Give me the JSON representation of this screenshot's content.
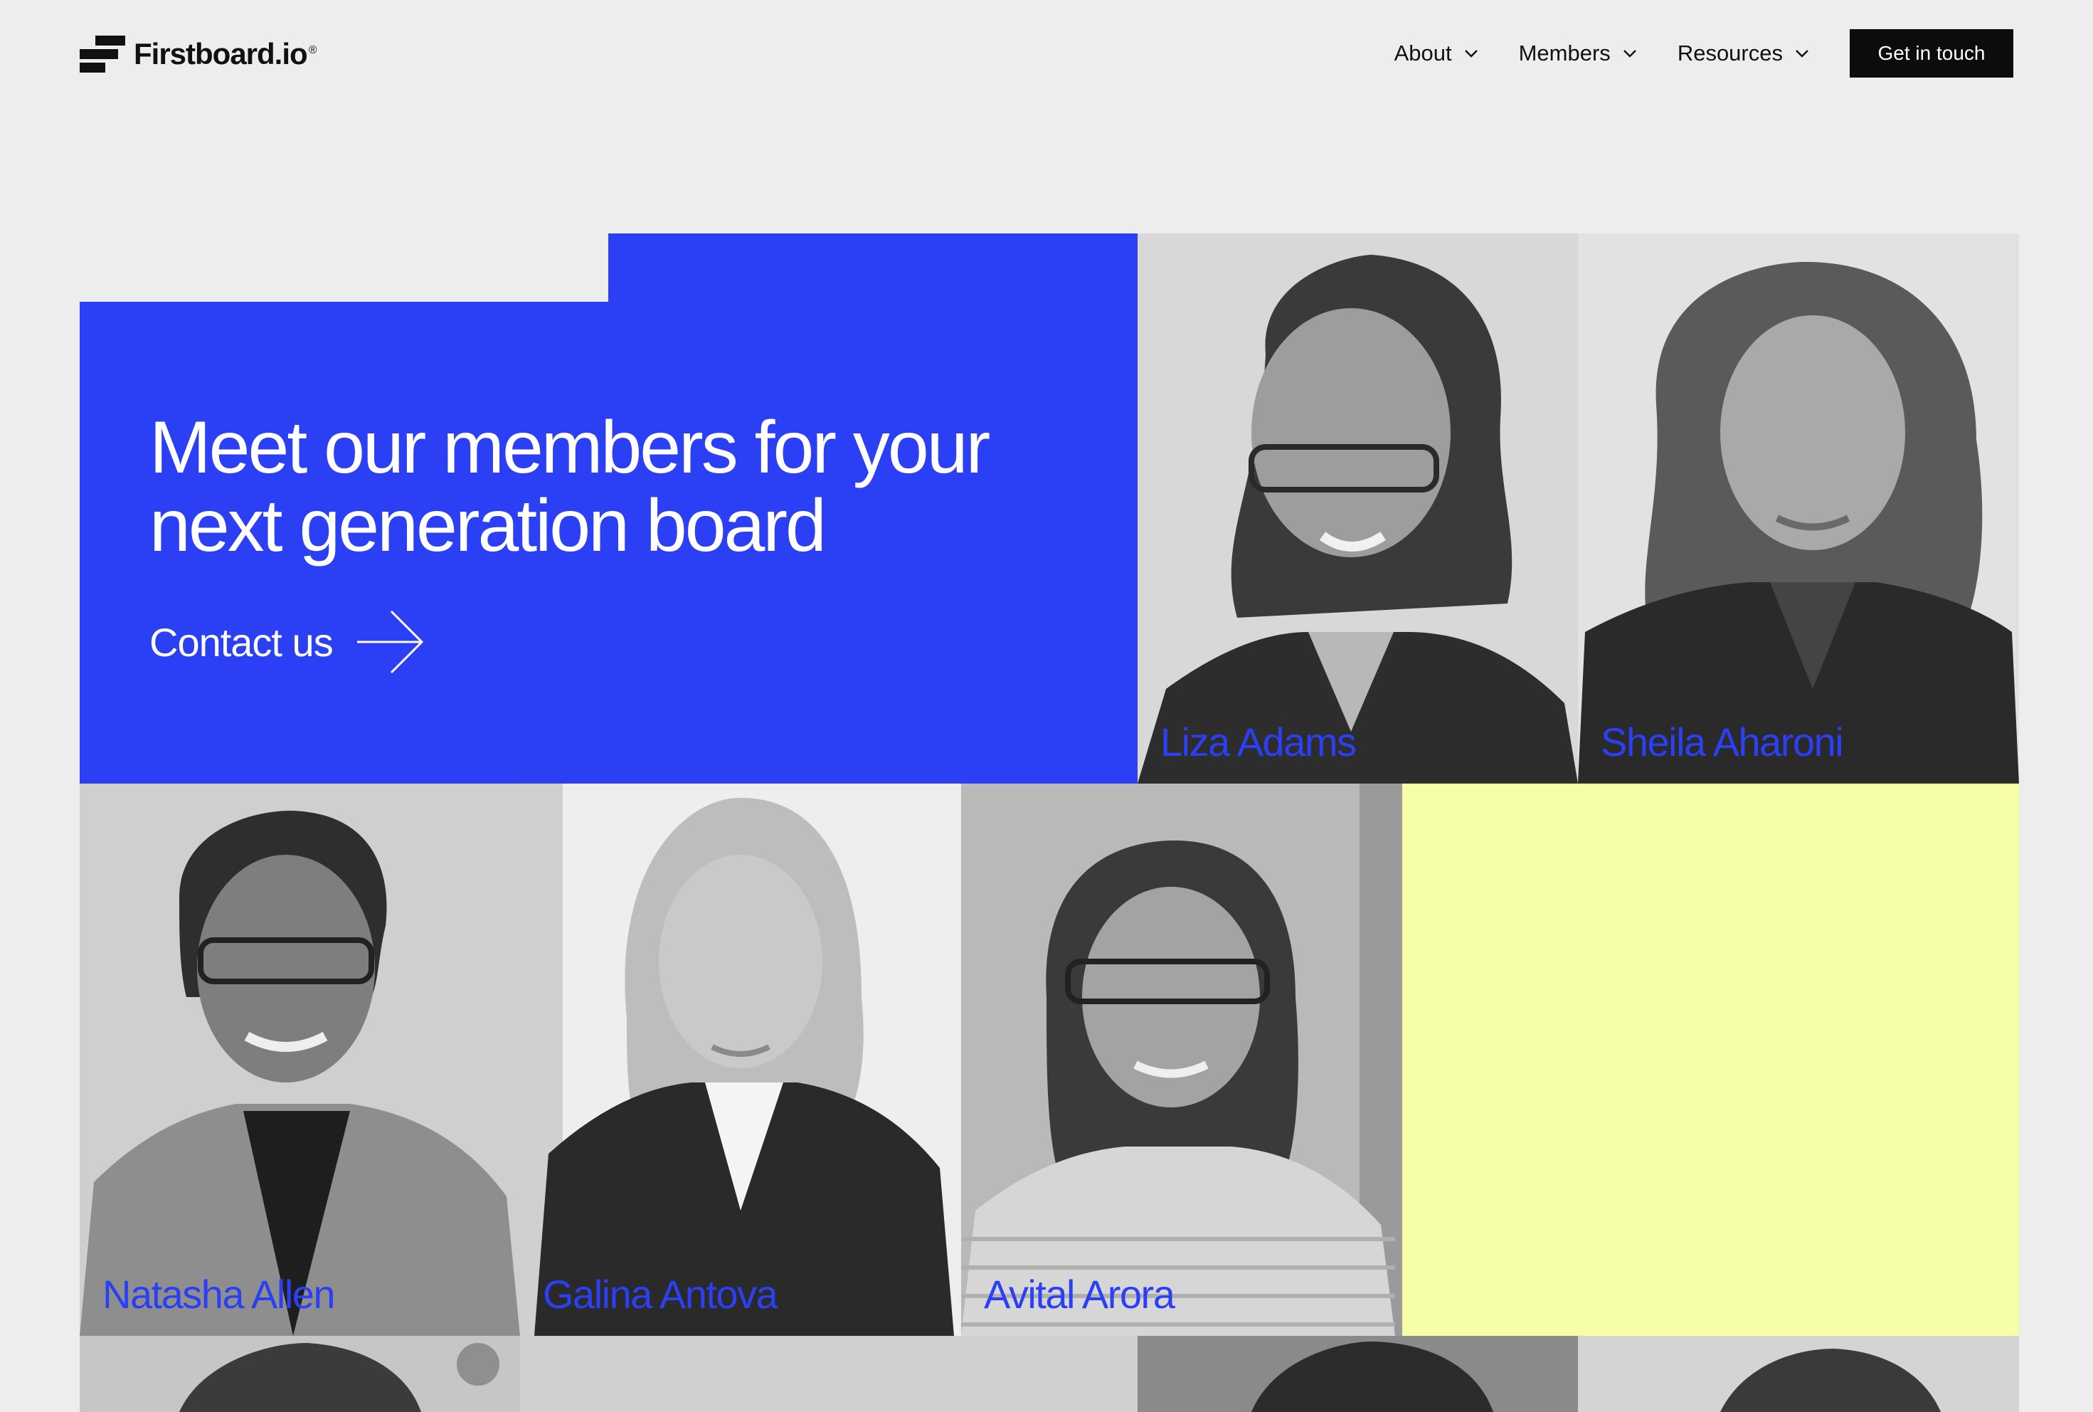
{
  "header": {
    "logo_text": "Firstboard.io",
    "logo_reg": "®",
    "nav": [
      {
        "label": "About",
        "icon": "chevron-down-icon"
      },
      {
        "label": "Members",
        "icon": "chevron-down-icon"
      },
      {
        "label": "Resources",
        "icon": "chevron-down-icon"
      }
    ],
    "cta_label": "Get in touch"
  },
  "hero": {
    "title_line1": "Meet our members for your",
    "title_line2": "next generation board",
    "contact_label": "Contact us",
    "contact_icon": "arrow-right-icon",
    "color": "#2b3ff5"
  },
  "members": [
    {
      "name": "Liza Adams"
    },
    {
      "name": "Sheila Aharoni"
    },
    {
      "name": "Natasha Allen"
    },
    {
      "name": "Galina Antova"
    },
    {
      "name": "Avital Arora"
    }
  ],
  "colors": {
    "accent": "#2b3ff5",
    "highlight": "#f6ffa6",
    "background": "#ededed",
    "cta_background": "#0c0c0c"
  }
}
